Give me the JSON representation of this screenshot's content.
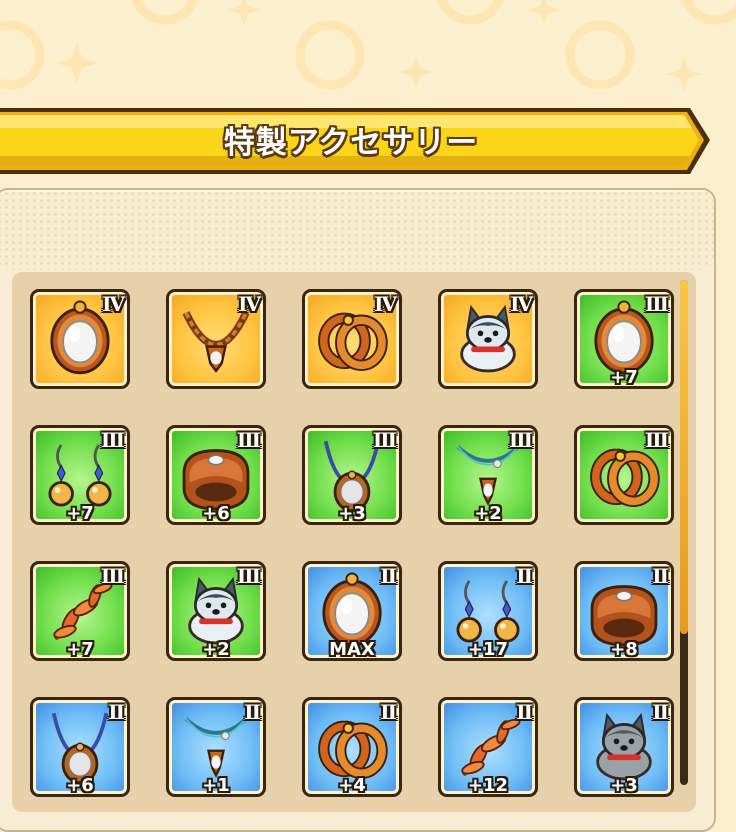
{
  "title": "特製アクセサリー",
  "colors": {
    "background": "#fbefcf",
    "banner": "#fbd51a",
    "rank_IV": "#ffc340",
    "rank_III": "#6fdd4a",
    "rank_II": "#6ebcf6"
  },
  "scroll_position": 0.7,
  "items": [
    {
      "icon": "mirror-pendant-icon",
      "rank": "IV",
      "level": ""
    },
    {
      "icon": "chain-necklace-icon",
      "rank": "IV",
      "level": ""
    },
    {
      "icon": "double-ring-icon",
      "rank": "IV",
      "level": ""
    },
    {
      "icon": "wolf-doll-icon",
      "rank": "IV",
      "level": ""
    },
    {
      "icon": "mirror-pendant-icon",
      "rank": "III",
      "level": "+7"
    },
    {
      "icon": "earrings-icon",
      "rank": "III",
      "level": "+7"
    },
    {
      "icon": "bracelet-icon",
      "rank": "III",
      "level": "+6"
    },
    {
      "icon": "amulet-necklace-icon",
      "rank": "III",
      "level": "+3"
    },
    {
      "icon": "pendant-necklace-icon",
      "rank": "III",
      "level": "+2"
    },
    {
      "icon": "double-ring-icon",
      "rank": "III",
      "level": ""
    },
    {
      "icon": "laurel-leaf-icon",
      "rank": "III",
      "level": "+7"
    },
    {
      "icon": "wolf-doll-icon",
      "rank": "III",
      "level": "+2"
    },
    {
      "icon": "mirror-pendant-icon",
      "rank": "II",
      "level": "MAX"
    },
    {
      "icon": "earrings-icon",
      "rank": "II",
      "level": "+17"
    },
    {
      "icon": "bracelet-icon",
      "rank": "II",
      "level": "+8"
    },
    {
      "icon": "amulet-necklace-icon",
      "rank": "II",
      "level": "+6"
    },
    {
      "icon": "pendant-necklace-icon",
      "rank": "II",
      "level": "+1"
    },
    {
      "icon": "double-ring-icon",
      "rank": "II",
      "level": "+4"
    },
    {
      "icon": "laurel-leaf-icon",
      "rank": "II",
      "level": "+12"
    },
    {
      "icon": "wolf-doll-icon",
      "rank": "II",
      "level": "+3"
    }
  ]
}
